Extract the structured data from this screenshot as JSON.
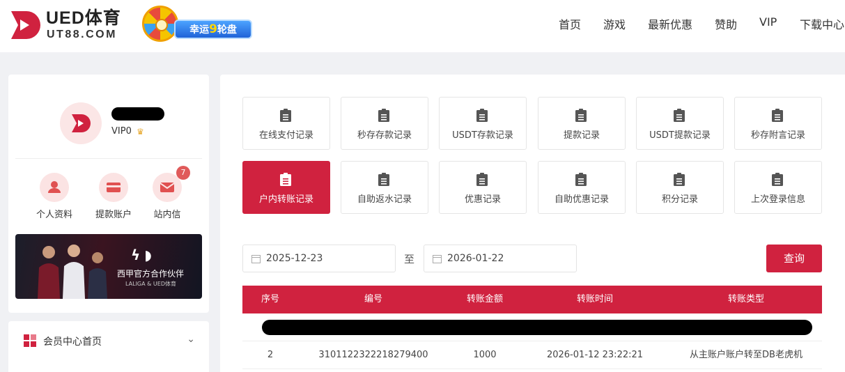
{
  "brand": {
    "name": "UED体育",
    "domain": "UT88.COM",
    "color": "#d0223f"
  },
  "promo": {
    "label_prefix": "幸运",
    "label_num": "9",
    "label_suffix": "轮盘"
  },
  "nav": [
    "首页",
    "游戏",
    "最新优惠",
    "赞助",
    "VIP",
    "下载中心"
  ],
  "user": {
    "vip_level": "VIP0"
  },
  "quick_links": [
    {
      "label": "个人资料",
      "icon": "user-icon"
    },
    {
      "label": "提款账户",
      "icon": "card-icon"
    },
    {
      "label": "站内信",
      "icon": "mail-icon",
      "badge": "7"
    }
  ],
  "partner_banner": {
    "title": "西甲官方合作伙伴",
    "subtitle": "LALIGA & UED体育"
  },
  "sidebar_menu": {
    "label": "会员中心首页"
  },
  "record_tabs": [
    {
      "label": "在线支付记录"
    },
    {
      "label": "秒存存款记录"
    },
    {
      "label": "USDT存款记录"
    },
    {
      "label": "提款记录"
    },
    {
      "label": "USDT提款记录"
    },
    {
      "label": "秒存附言记录"
    },
    {
      "label": "户内转账记录",
      "active": true
    },
    {
      "label": "自助返水记录"
    },
    {
      "label": "优惠记录"
    },
    {
      "label": "自助优惠记录"
    },
    {
      "label": "积分记录"
    },
    {
      "label": "上次登录信息"
    }
  ],
  "filter": {
    "start_date": "2025-12-23",
    "separator": "至",
    "end_date": "2026-01-22",
    "query_label": "查询"
  },
  "table": {
    "headers": [
      "序号",
      "编号",
      "转账金额",
      "转账时间",
      "转账类型"
    ],
    "rows": [
      {
        "index": "2",
        "id": "3101122322218279400",
        "amount": "1000",
        "time": "2026-01-12 23:22:21",
        "type": "从主账户账户转至DB老虎机"
      }
    ]
  }
}
